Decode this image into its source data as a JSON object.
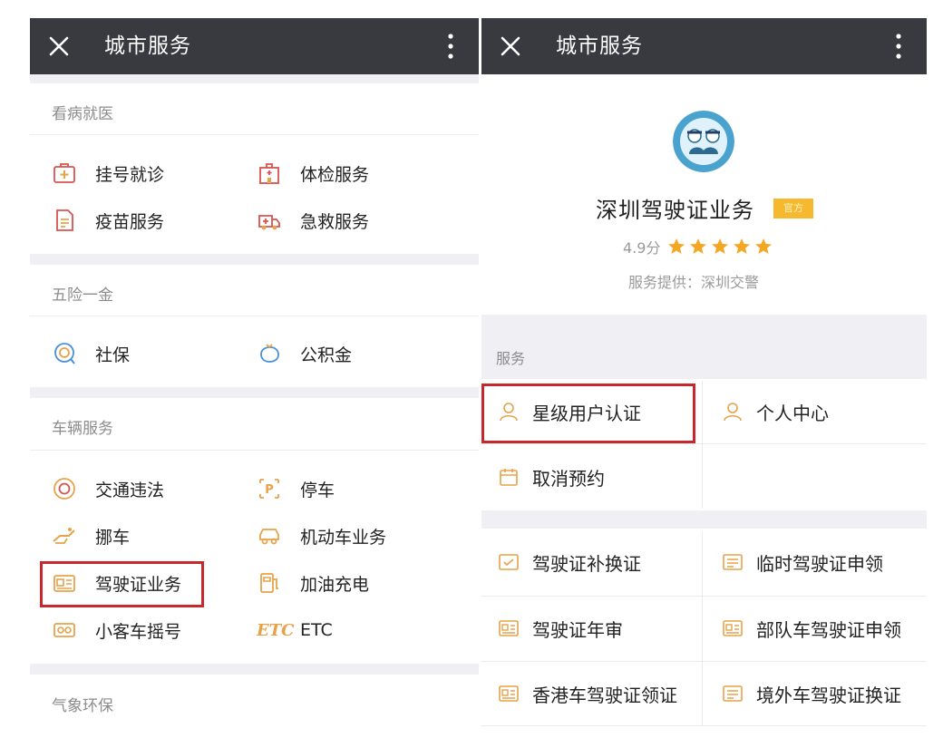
{
  "left": {
    "topbar": {
      "title": "城市服务"
    },
    "sections": {
      "medical": {
        "title": "看病就医",
        "items": [
          "挂号就诊",
          "体检服务",
          "疫苗服务",
          "急救服务"
        ]
      },
      "insurance": {
        "title": "五险一金",
        "items": [
          "社保",
          "公积金"
        ]
      },
      "vehicle": {
        "title": "车辆服务",
        "items": [
          "交通违法",
          "停车",
          "挪车",
          "机动车业务",
          "驾驶证业务",
          "加油充电",
          "小客车摇号",
          "ETC"
        ],
        "etc_icon_text": "ETC"
      },
      "environment": {
        "title": "气象环保"
      }
    }
  },
  "right": {
    "topbar": {
      "title": "城市服务"
    },
    "app": {
      "name": "深圳驾驶证业务",
      "badge": "官方",
      "rating": "4.9分",
      "stars": 5,
      "provider": "服务提供：深圳交警"
    },
    "services": {
      "title": "服务",
      "row1": [
        "星级用户认证",
        "个人中心"
      ],
      "row2": [
        "取消预约"
      ]
    },
    "license": {
      "items": [
        "驾驶证补换证",
        "临时驾驶证申领",
        "驾驶证年审",
        "部队车驾驶证申领",
        "香港车驾驶证领证",
        "境外车驾驶证换证"
      ]
    }
  },
  "colors": {
    "topbar": "#393a3f",
    "icon_red": "#d9534f",
    "icon_orange": "#e7a24a",
    "icon_blue": "#4a90d9",
    "highlight": "#c7282e",
    "badge": "#f5b82e",
    "star": "#f5a623"
  }
}
